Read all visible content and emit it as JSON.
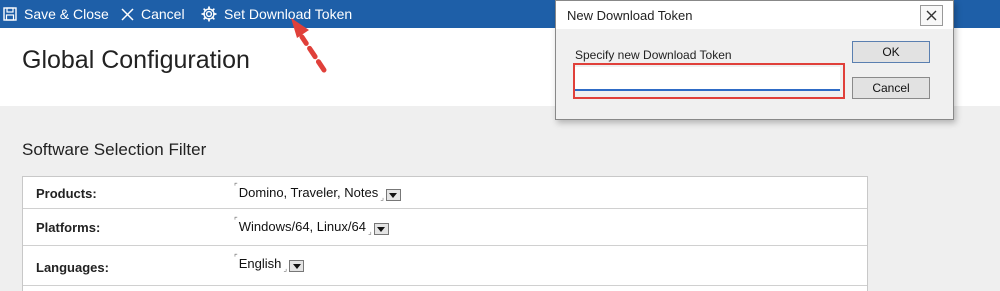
{
  "toolbar": {
    "save_close_label": "Save & Close",
    "cancel_label": "Cancel",
    "set_token_label": "Set Download Token"
  },
  "page": {
    "title": "Global Configuration",
    "section_title": "Software Selection Filter"
  },
  "filter": {
    "rows": [
      {
        "label": "Products:",
        "value": "Domino, Traveler, Notes"
      },
      {
        "label": "Platforms:",
        "value": "Windows/64, Linux/64"
      },
      {
        "label": "Languages:",
        "value": "English"
      }
    ]
  },
  "dialog": {
    "title": "New Download Token",
    "field_label": "Specify new Download Token",
    "token_value": "",
    "ok_label": "OK",
    "cancel_label": "Cancel",
    "close_icon": "close-icon"
  },
  "colors": {
    "toolbar_bg": "#1e5fa8",
    "highlight": "#e0403a",
    "arrow": "#e0403a"
  },
  "icons": {
    "save": "save-icon",
    "cancel": "close-icon",
    "settings": "gear-icon"
  }
}
